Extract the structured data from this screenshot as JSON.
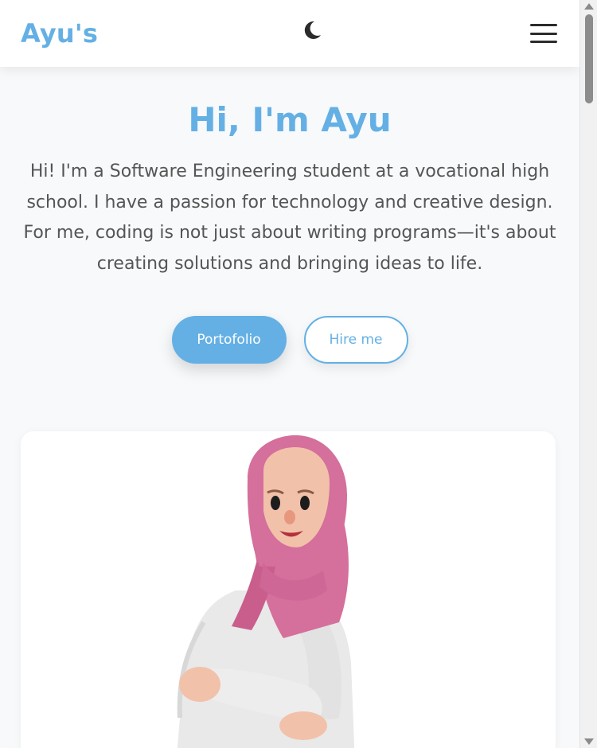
{
  "header": {
    "brand": "Ayu's",
    "theme_toggle_icon": "moon-icon",
    "menu_icon": "hamburger-menu-icon"
  },
  "hero": {
    "title": "Hi, I'm Ayu",
    "description": "Hi! I'm a Software Engineering student at a vocational high school. I have a passion for technology and creative design. For me, coding is not just about writing programs—it's about creating solutions and bringing ideas to life.",
    "primary_button": "Portofolio",
    "secondary_button": "Hire me"
  },
  "illustration": {
    "icon": "character-illustration",
    "colors": {
      "hijab": "#d56f9b",
      "shirt": "#e9e9e9",
      "skin": "#f2c1aa"
    }
  },
  "theme": {
    "accent": "#64b0e5",
    "text": "#555555",
    "background": "#f7f9fb"
  }
}
